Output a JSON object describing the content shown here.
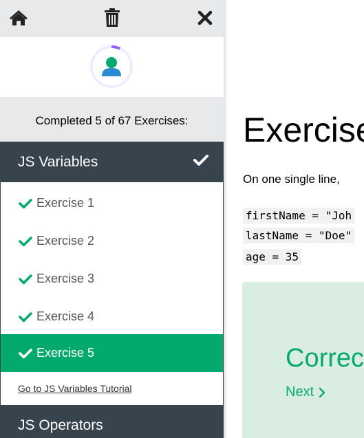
{
  "colors": {
    "accent": "#04aa6d",
    "sidebar_bg": "#e7e9eb",
    "header_bg": "#38444d",
    "correct_bg": "#d9eee1",
    "avatar_ring": "#9763f6"
  },
  "toolbar": {
    "icons": [
      "home-icon",
      "trash-icon",
      "close-icon"
    ]
  },
  "progress": {
    "text": "Completed 5 of 67 Exercises:",
    "completed": 5,
    "total": 67
  },
  "sections": [
    {
      "title": "JS Variables",
      "completed": true,
      "items": [
        {
          "label": "Exercise 1",
          "done": true,
          "active": false
        },
        {
          "label": "Exercise 2",
          "done": true,
          "active": false
        },
        {
          "label": "Exercise 3",
          "done": true,
          "active": false
        },
        {
          "label": "Exercise 4",
          "done": true,
          "active": false
        },
        {
          "label": "Exercise 5",
          "done": true,
          "active": true
        }
      ],
      "tutorial_link": "Go to JS Variables Tutorial"
    },
    {
      "title": "JS Operators"
    }
  ],
  "main": {
    "title": "Exercise",
    "instruction": "On one single line,",
    "code_lines": [
      "firstName = \"Joh",
      "lastName = \"Doe\"",
      "age = 35"
    ],
    "result": "Correc",
    "next_label": "Next"
  }
}
